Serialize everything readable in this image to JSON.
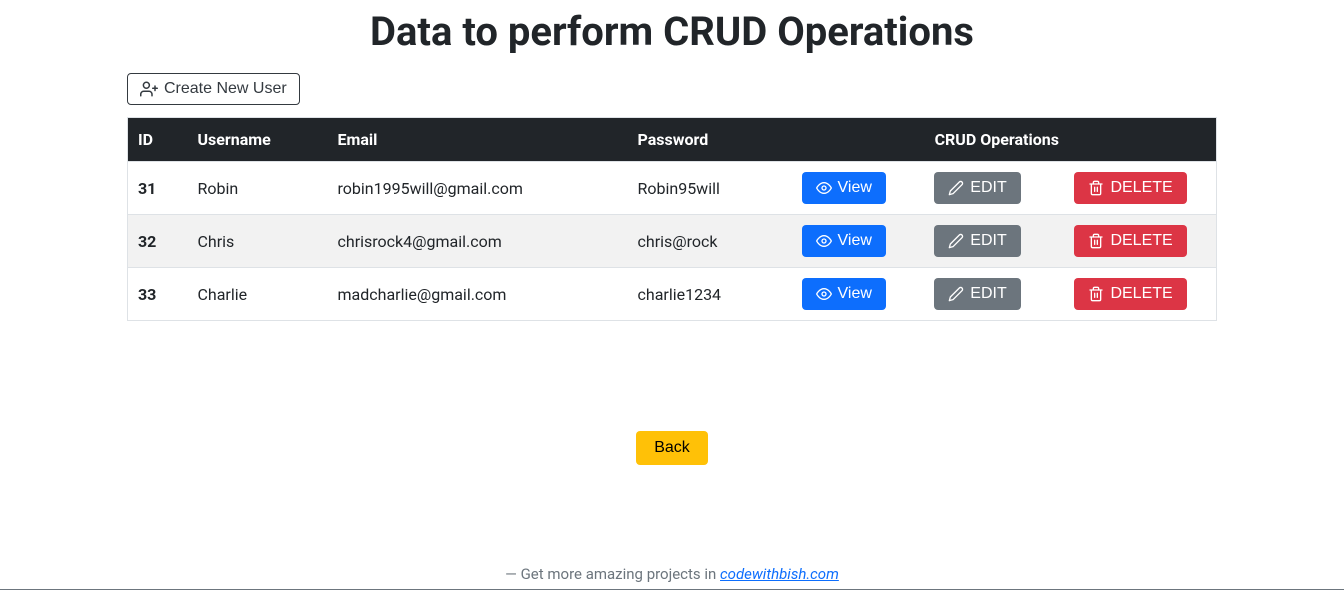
{
  "page_title": "Data to perform CRUD Operations",
  "create_button_label": "Create New User",
  "columns": {
    "id": "ID",
    "username": "Username",
    "email": "Email",
    "password": "Password",
    "crud": "CRUD Operations"
  },
  "actions": {
    "view": "View",
    "edit": "EDIT",
    "delete": "DELETE"
  },
  "rows": [
    {
      "id": "31",
      "username": "Robin",
      "email": "robin1995will@gmail.com",
      "password": "Robin95will"
    },
    {
      "id": "32",
      "username": "Chris",
      "email": "chrisrock4@gmail.com",
      "password": "chris@rock"
    },
    {
      "id": "33",
      "username": "Charlie",
      "email": "madcharlie@gmail.com",
      "password": "charlie1234"
    }
  ],
  "back_label": "Back",
  "footer": {
    "prefix": "— Get more amazing projects in ",
    "link_text": "codewithbish.com"
  }
}
